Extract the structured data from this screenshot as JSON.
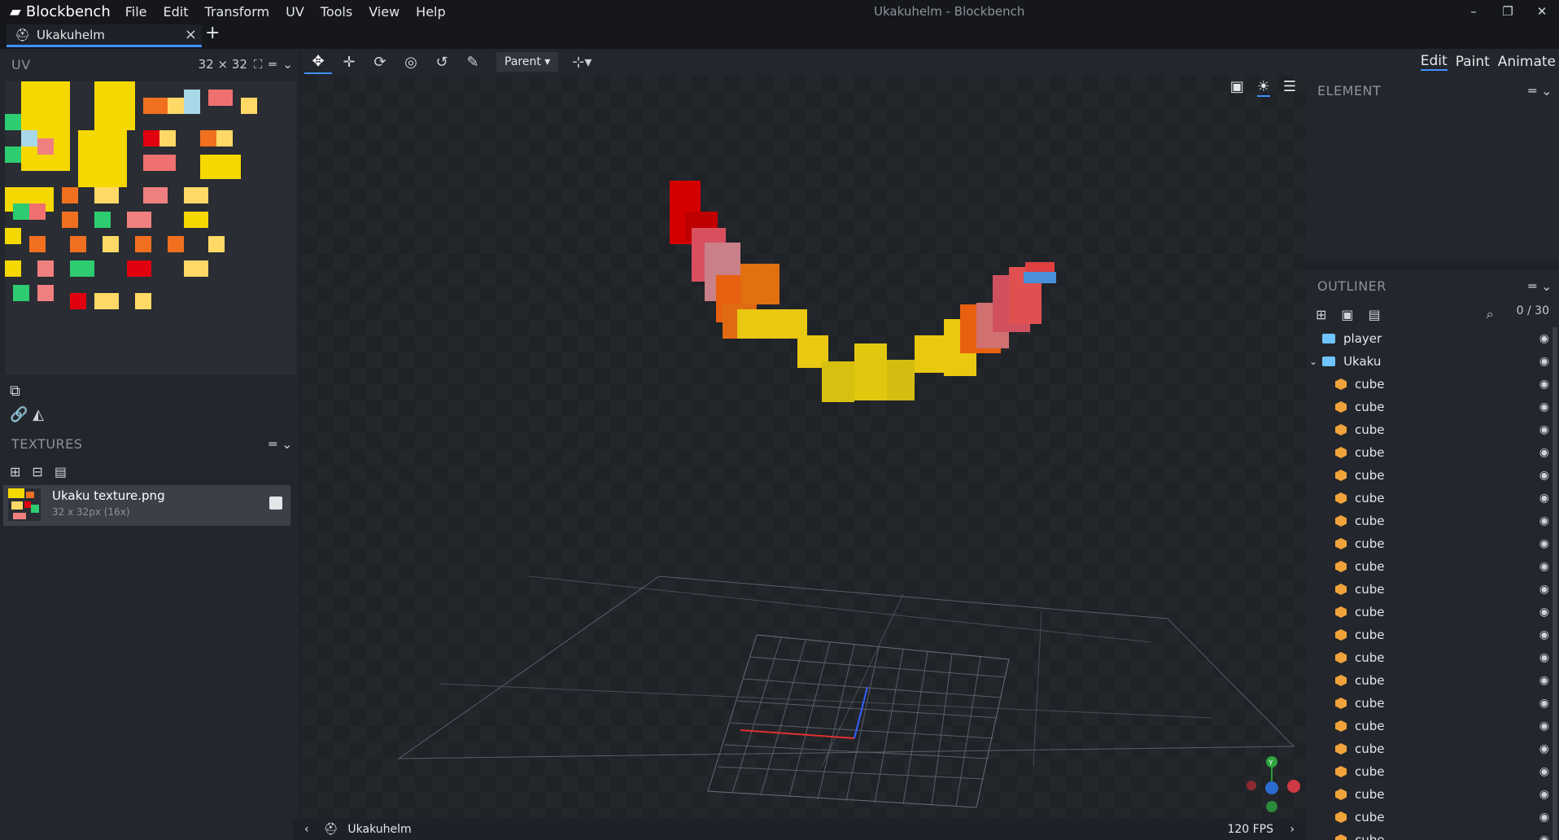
{
  "app": {
    "name": "Blockbench",
    "window_title": "Ukakuhelm - Blockbench"
  },
  "menu": [
    "File",
    "Edit",
    "Transform",
    "UV",
    "Tools",
    "View",
    "Help"
  ],
  "window_controls": [
    "–",
    "❐",
    "✕"
  ],
  "tab": {
    "label": "Ukakuhelm",
    "close": "×",
    "add": "+"
  },
  "uv": {
    "title": "UV",
    "size_label": "32 ⨯ 32"
  },
  "textures": {
    "title": "TEXTURES",
    "item": {
      "name": "Ukaku texture.png",
      "meta": "32 x 32px (16x)"
    }
  },
  "toolbar": {
    "pivot_select": "Parent"
  },
  "modes": [
    "Edit",
    "Paint",
    "Animate"
  ],
  "element": {
    "title": "ELEMENT"
  },
  "outliner": {
    "title": "OUTLINER",
    "count": "0 / 30",
    "groups": [
      {
        "label": "player"
      },
      {
        "label": "Ukaku"
      }
    ],
    "cubes": [
      "cube",
      "cube",
      "cube",
      "cube",
      "cube",
      "cube",
      "cube",
      "cube",
      "cube",
      "cube",
      "cube",
      "cube",
      "cube",
      "cube",
      "cube",
      "cube",
      "cube",
      "cube",
      "cube",
      "cube",
      "cube"
    ]
  },
  "status": {
    "model": "Ukakuhelm",
    "fps": "120 FPS"
  },
  "colors": {
    "accent": "#3e90ff",
    "cube_icon": "#f0a33a",
    "folder_icon": "#6fc4ff"
  }
}
